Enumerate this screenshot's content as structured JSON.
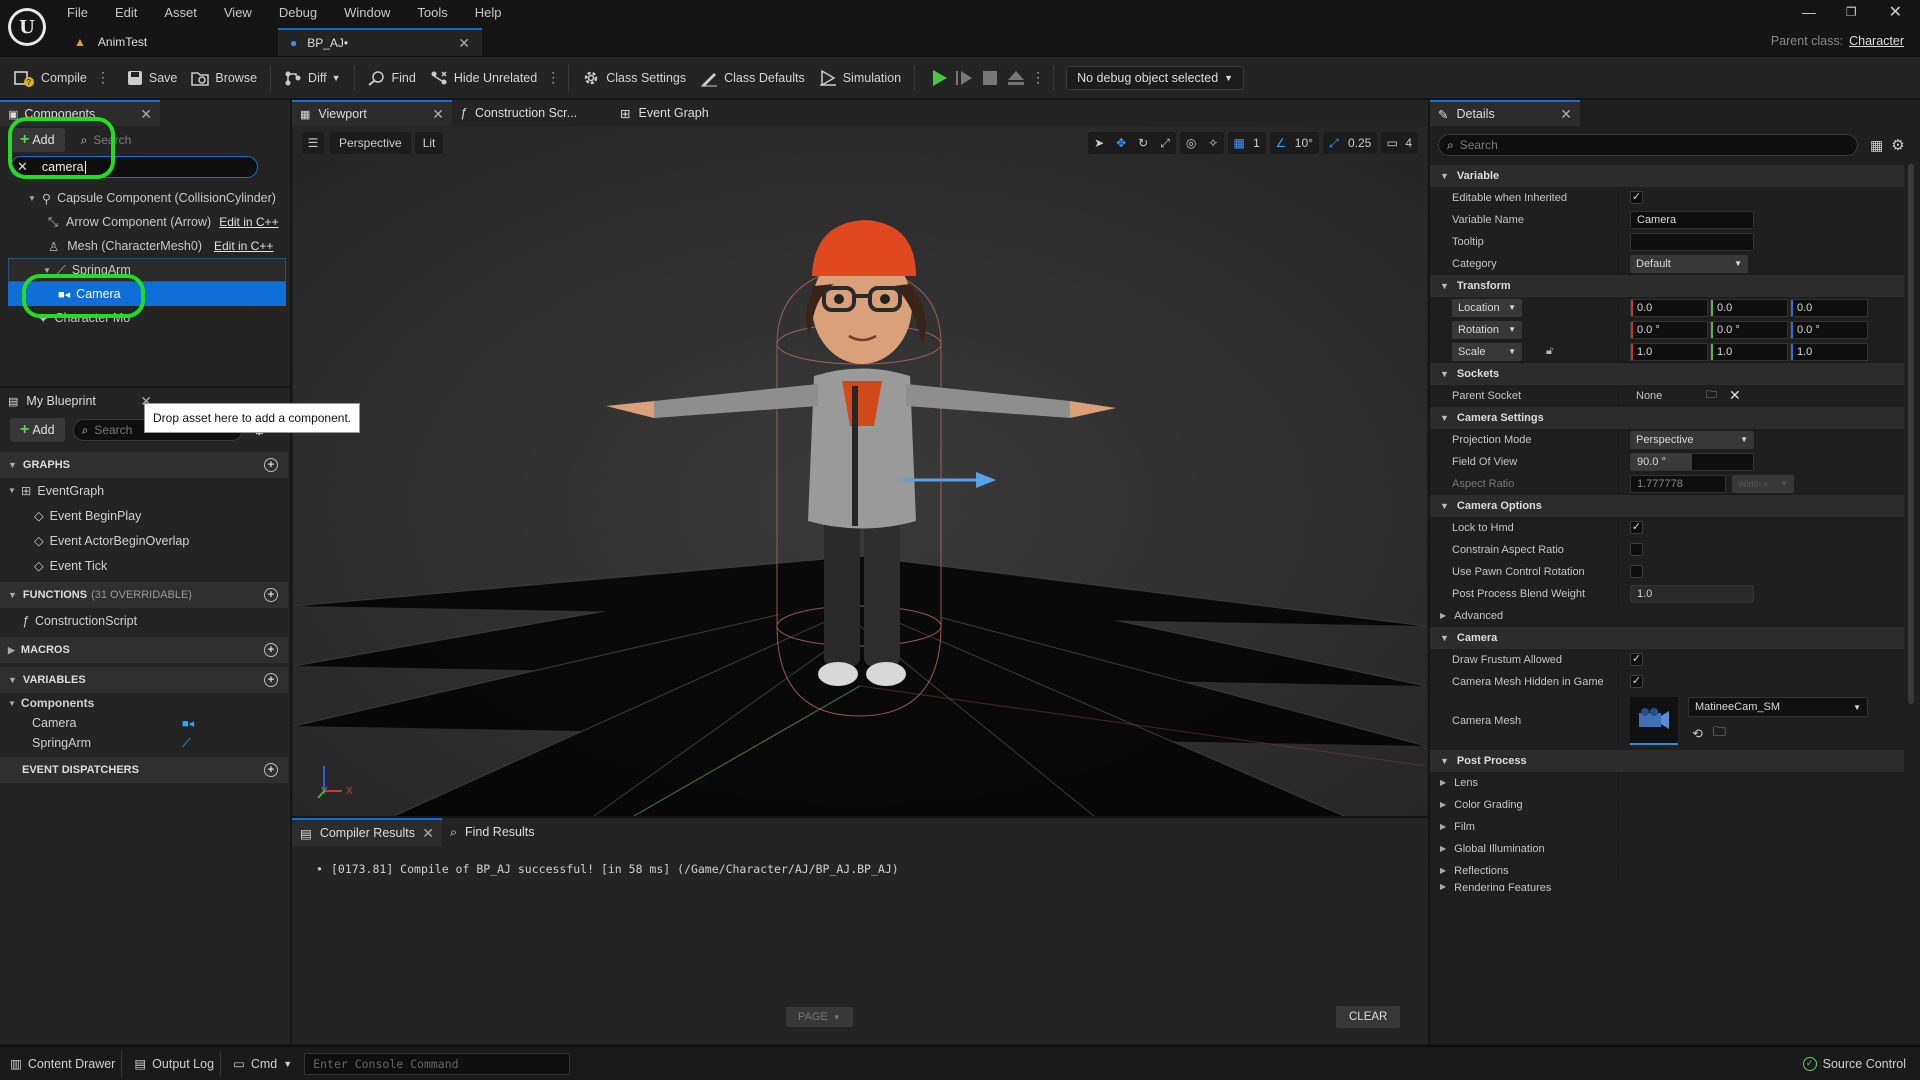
{
  "menu": [
    "File",
    "Edit",
    "Asset",
    "View",
    "Debug",
    "Window",
    "Tools",
    "Help"
  ],
  "doc_tabs": [
    {
      "label": "AnimTest",
      "active": false
    },
    {
      "label": "BP_AJ•",
      "active": true
    }
  ],
  "parent_class": {
    "label": "Parent class:",
    "value": "Character"
  },
  "toolbar": {
    "compile": "Compile",
    "save": "Save",
    "browse": "Browse",
    "diff": "Diff",
    "find": "Find",
    "hide_unrelated": "Hide Unrelated",
    "class_settings": "Class Settings",
    "class_defaults": "Class Defaults",
    "simulation": "Simulation",
    "debug_select": "No debug object selected"
  },
  "components_panel": {
    "tab": "Components",
    "add": "Add",
    "search_placeholder": "Search",
    "search_value": "camera",
    "tree": [
      {
        "label": "Capsule Component (CollisionCylinder)",
        "indent": 1,
        "edit": ""
      },
      {
        "label": "Arrow Component (Arrow)",
        "indent": 2,
        "edit": "Edit in C++"
      },
      {
        "label": "Mesh (CharacterMesh0)",
        "indent": 2,
        "edit": "Edit in C++"
      },
      {
        "label": "SpringArm",
        "indent": 2,
        "edit": ""
      },
      {
        "label": "Camera",
        "indent": 3,
        "edit": "",
        "selected": true
      },
      {
        "label": "Character Mo",
        "indent": 1,
        "edit": ""
      }
    ],
    "tooltip": "Drop asset here to add a component."
  },
  "my_blueprint": {
    "tab": "My Blueprint",
    "add": "Add",
    "search_placeholder": "Search",
    "graphs_header": "GRAPHS",
    "event_graph": "EventGraph",
    "events": [
      "Event BeginPlay",
      "Event ActorBeginOverlap",
      "Event Tick"
    ],
    "functions_header": "FUNCTIONS",
    "functions_count": "(31 OVERRIDABLE)",
    "construction_script": "ConstructionScript",
    "macros_header": "MACROS",
    "variables_header": "VARIABLES",
    "components_group": "Components",
    "variables": [
      "Camera",
      "SpringArm"
    ],
    "dispatchers_header": "EVENT DISPATCHERS"
  },
  "editor_tabs": [
    {
      "label": "Viewport",
      "active": true
    },
    {
      "label": "Construction Scr...",
      "active": false
    },
    {
      "label": "Event Graph",
      "active": false
    }
  ],
  "viewport": {
    "perspective": "Perspective",
    "lit": "Lit",
    "grid_value": "1",
    "angle_value": "10°",
    "scale_value": "0.25",
    "camera_speed": "4",
    "axis_y": "Y",
    "axis_x": "X"
  },
  "output_panel": {
    "tabs": [
      "Compiler Results",
      "Find Results"
    ],
    "log_line": "[0173.81] Compile of BP_AJ successful! [in 58 ms] (/Game/Character/AJ/BP_AJ.BP_AJ)",
    "page": "PAGE",
    "clear": "CLEAR"
  },
  "details": {
    "tab": "Details",
    "search_placeholder": "Search",
    "variable_section": "Variable",
    "editable_when_inherited": "Editable when Inherited",
    "variable_name_label": "Variable Name",
    "variable_name": "Camera",
    "tooltip_label": "Tooltip",
    "category_label": "Category",
    "category": "Default",
    "transform_section": "Transform",
    "location_label": "Location",
    "location": [
      "0.0",
      "0.0",
      "0.0"
    ],
    "rotation_label": "Rotation",
    "rotation": [
      "0.0 °",
      "0.0 °",
      "0.0 °"
    ],
    "scale_label": "Scale",
    "scale": [
      "1.0",
      "1.0",
      "1.0"
    ],
    "sockets_section": "Sockets",
    "parent_socket_label": "Parent Socket",
    "parent_socket": "None",
    "camera_settings_section": "Camera Settings",
    "projection_mode_label": "Projection Mode",
    "projection_mode": "Perspective",
    "fov_label": "Field Of View",
    "fov": "90.0 °",
    "aspect_ratio_label": "Aspect Ratio",
    "aspect_ratio": "1.777778",
    "aspect_ratio_preset": "Width x",
    "camera_options_section": "Camera Options",
    "lock_to_hmd": "Lock to Hmd",
    "constrain_aspect": "Constrain Aspect Ratio",
    "use_pawn_control": "Use Pawn Control Rotation",
    "post_process_blend_label": "Post Process Blend Weight",
    "post_process_blend": "1.0",
    "advanced": "Advanced",
    "camera_section": "Camera",
    "draw_frustum": "Draw Frustum Allowed",
    "mesh_hidden": "Camera Mesh Hidden in Game",
    "camera_mesh_label": "Camera Mesh",
    "camera_mesh": "MatineeCam_SM",
    "post_process_section": "Post Process",
    "pp_items": [
      "Lens",
      "Color Grading",
      "Film",
      "Global Illumination",
      "Reflections",
      "Rendering Features"
    ]
  },
  "statusbar": {
    "content_drawer": "Content Drawer",
    "output_log": "Output Log",
    "cmd": "Cmd",
    "console_placeholder": "Enter Console Command",
    "source_control": "Source Control"
  },
  "colors": {
    "accent_blue": "#0e6fd8",
    "highlight_green": "#22dd22",
    "play_green": "#46c846"
  }
}
